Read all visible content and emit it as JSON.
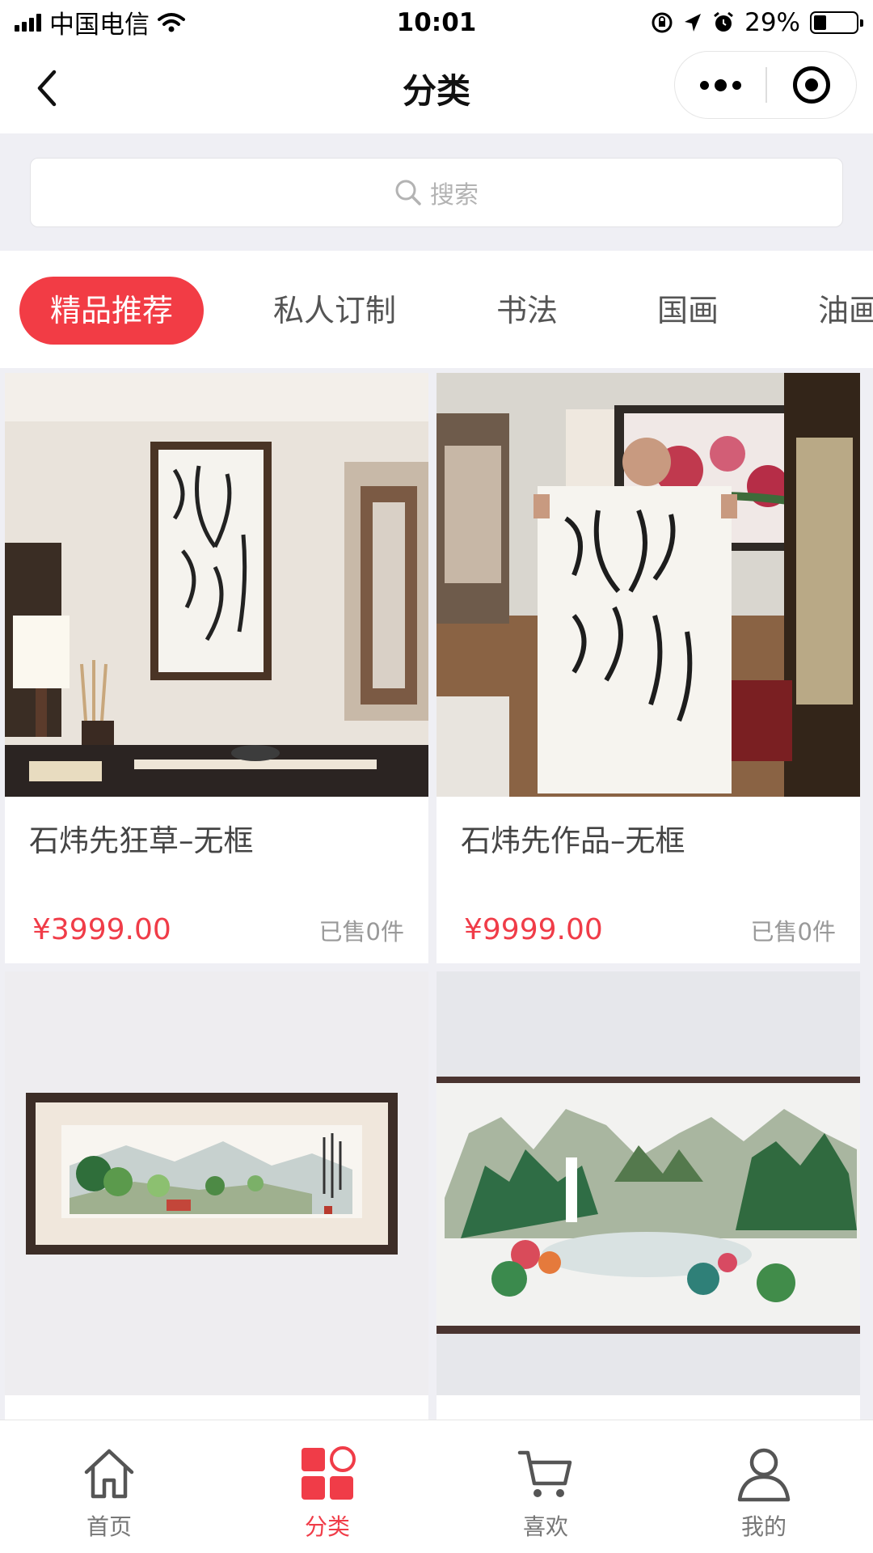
{
  "status_bar": {
    "carrier": "中国电信",
    "time": "10:01",
    "battery_percent": "29%",
    "battery_level": 0.29
  },
  "nav": {
    "title": "分类"
  },
  "search": {
    "placeholder": "搜索"
  },
  "tabs": [
    {
      "label": "精品推荐",
      "active": true
    },
    {
      "label": "私人订制",
      "active": false
    },
    {
      "label": "书法",
      "active": false
    },
    {
      "label": "国画",
      "active": false
    },
    {
      "label": "油画",
      "active": false
    }
  ],
  "products": [
    {
      "title": "石炜先狂草–无框",
      "price": "¥3999.00",
      "sold": "已售0件"
    },
    {
      "title": "石炜先作品–无框",
      "price": "¥9999.00",
      "sold": "已售0件"
    },
    {
      "title": "",
      "price": "",
      "sold": ""
    },
    {
      "title": "",
      "price": "",
      "sold": ""
    }
  ],
  "tab_bar": [
    {
      "label": "首页",
      "icon": "home-icon",
      "active": false
    },
    {
      "label": "分类",
      "icon": "category-icon",
      "active": true
    },
    {
      "label": "喜欢",
      "icon": "cart-icon",
      "active": false
    },
    {
      "label": "我的",
      "icon": "user-icon",
      "active": false
    }
  ],
  "colors": {
    "accent": "#f23c45",
    "price": "#f03c48",
    "background": "#efeff4"
  }
}
